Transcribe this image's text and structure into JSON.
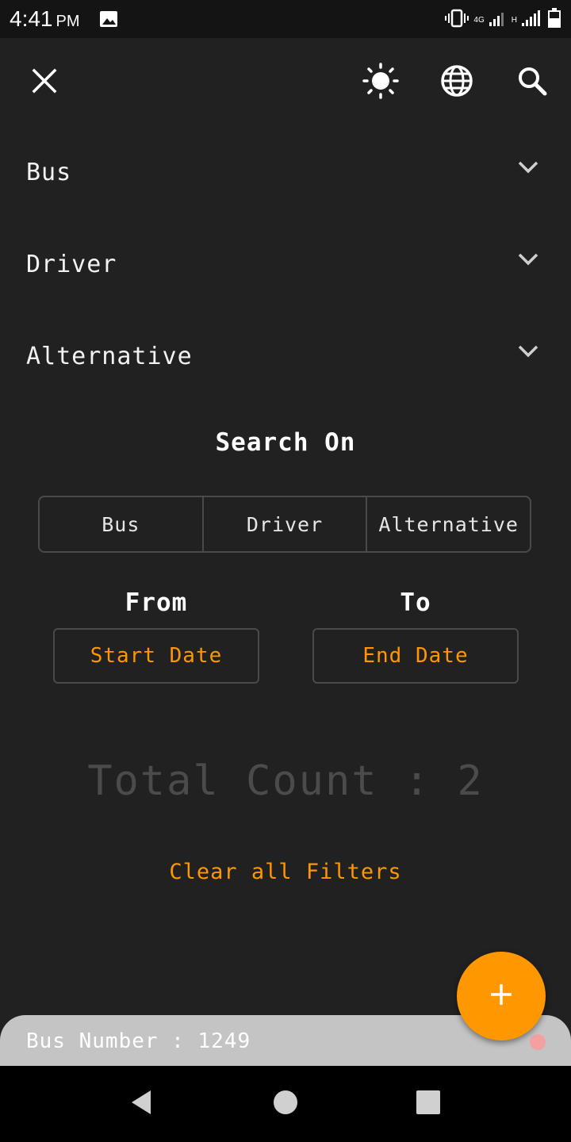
{
  "status_bar": {
    "time": "4:41",
    "ampm": "PM",
    "network_4g": "4G",
    "network_h": "H"
  },
  "toolbar": {
    "close_icon": "close-icon",
    "theme_icon": "sun-icon",
    "language_icon": "globe-icon",
    "search_icon": "search-icon"
  },
  "filters": [
    {
      "label": "Bus"
    },
    {
      "label": "Driver"
    },
    {
      "label": "Alternative"
    }
  ],
  "search_on": {
    "title": "Search On",
    "options": [
      "Bus",
      "Driver",
      "Alternative"
    ]
  },
  "date_range": {
    "from_label": "From",
    "to_label": "To",
    "start_placeholder": "Start Date",
    "end_placeholder": "End Date"
  },
  "total_count_text": "Total Count : 2",
  "clear_filters_label": "Clear all Filters",
  "bottom_card": {
    "label": "Bus Number : 1249"
  },
  "colors": {
    "accent": "#ff9800",
    "background": "#212121"
  }
}
